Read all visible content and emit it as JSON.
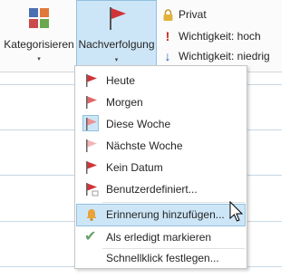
{
  "ribbon": {
    "kategorisieren_label": "Kategorisieren",
    "nachverfolgung_label": "Nachverfolgung",
    "privat_label": "Privat",
    "wichtigkeit_hoch_label": "Wichtigkeit: hoch",
    "wichtigkeit_niedrig_label": "Wichtigkeit: niedrig",
    "wichtigkeit_hoch_icon": "!",
    "wichtigkeit_niedrig_icon": "↓",
    "caret": "▾"
  },
  "menu": {
    "items": [
      {
        "label": "Heute",
        "icon": "flag-icon"
      },
      {
        "label": "Morgen",
        "icon": "flag-icon"
      },
      {
        "label": "Diese Woche",
        "icon": "flag-icon"
      },
      {
        "label": "Nächste Woche",
        "icon": "flag-icon"
      },
      {
        "label": "Kein Datum",
        "icon": "flag-icon"
      },
      {
        "label": "Benutzerdefiniert...",
        "icon": "flag-custom-icon"
      },
      {
        "label": "Erinnerung hinzufügen...",
        "icon": "bell-icon"
      },
      {
        "label": "Als erledigt markieren",
        "icon": "checkmark-icon"
      },
      {
        "label": "Schnellklick festlegen...",
        "icon": ""
      }
    ],
    "check_glyph": "✔"
  },
  "colors": {
    "flag_strong": "#d13438",
    "flag_light": "#f0a0a0",
    "highlight_bg": "#cde6f7",
    "highlight_border": "#92c0e0",
    "bell": "#e8a33a",
    "check": "#6a9f6a",
    "importance_high": "#c62828",
    "importance_low": "#1e5fa8"
  }
}
